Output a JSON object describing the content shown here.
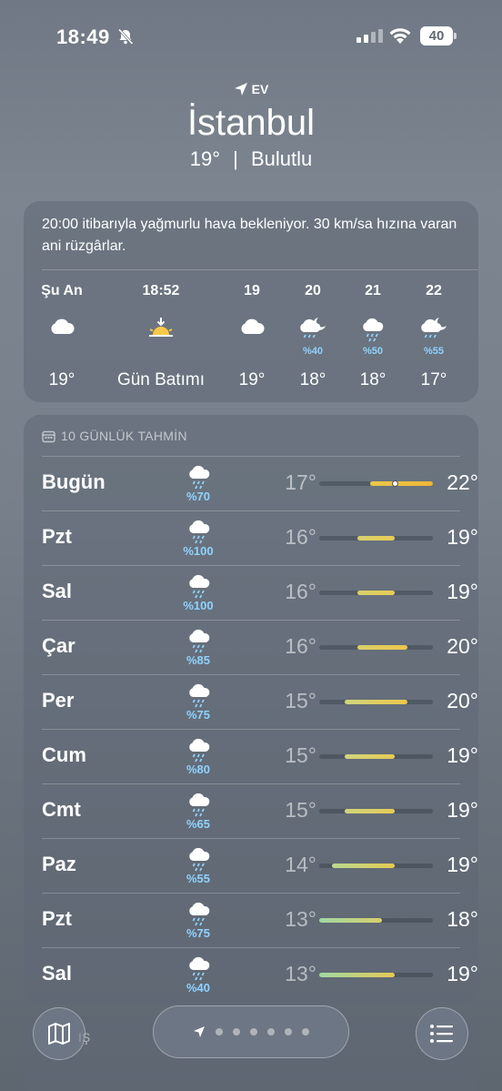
{
  "status_bar": {
    "time": "18:49",
    "battery": "40"
  },
  "location": {
    "tag": "EV",
    "city": "İstanbul",
    "temp": "19°",
    "separator": "|",
    "condition": "Bulutlu"
  },
  "hourly": {
    "summary": "20:00 itibarıyla yağmurlu hava bekleniyor. 30 km/sa hızına varan ani rüzgârlar.",
    "items": [
      {
        "label": "Şu An",
        "icon": "cloud-icon",
        "prob": "",
        "temp": "19°"
      },
      {
        "label": "18:52",
        "icon": "sunset-icon",
        "prob": "",
        "temp": "Gün Batımı"
      },
      {
        "label": "19",
        "icon": "cloud-icon",
        "prob": "",
        "temp": "19°"
      },
      {
        "label": "20",
        "icon": "moon-rain-icon",
        "prob": "%40",
        "temp": "18°"
      },
      {
        "label": "21",
        "icon": "cloud-rain-icon",
        "prob": "%50",
        "temp": "18°"
      },
      {
        "label": "22",
        "icon": "moon-rain-icon",
        "prob": "%55",
        "temp": "17°"
      }
    ]
  },
  "daily": {
    "title": "10 GÜNLÜK TAHMİN",
    "range": {
      "min": 13,
      "max": 22
    },
    "items": [
      {
        "day": "Bugün",
        "prob": "%70",
        "low": "17°",
        "high": "22°",
        "low_val": 17,
        "high_val": 22,
        "current": 19,
        "colors": [
          "#e8c84a",
          "#f2b537"
        ]
      },
      {
        "day": "Pzt",
        "prob": "%100",
        "low": "16°",
        "high": "19°",
        "low_val": 16,
        "high_val": 19,
        "colors": [
          "#d9d06a",
          "#e6cb55"
        ]
      },
      {
        "day": "Sal",
        "prob": "%100",
        "low": "16°",
        "high": "19°",
        "low_val": 16,
        "high_val": 19,
        "colors": [
          "#d9d06a",
          "#e6cb55"
        ]
      },
      {
        "day": "Çar",
        "prob": "%85",
        "low": "16°",
        "high": "20°",
        "low_val": 16,
        "high_val": 20,
        "colors": [
          "#d9d06a",
          "#ecc64a"
        ]
      },
      {
        "day": "Per",
        "prob": "%75",
        "low": "15°",
        "high": "20°",
        "low_val": 15,
        "high_val": 20,
        "colors": [
          "#cfd67c",
          "#ecc64a"
        ]
      },
      {
        "day": "Cum",
        "prob": "%80",
        "low": "15°",
        "high": "19°",
        "low_val": 15,
        "high_val": 19,
        "colors": [
          "#cfd67c",
          "#e6cb55"
        ]
      },
      {
        "day": "Cmt",
        "prob": "%65",
        "low": "15°",
        "high": "19°",
        "low_val": 15,
        "high_val": 19,
        "colors": [
          "#cfd67c",
          "#e6cb55"
        ]
      },
      {
        "day": "Paz",
        "prob": "%55",
        "low": "14°",
        "high": "19°",
        "low_val": 14,
        "high_val": 19,
        "colors": [
          "#b9d98e",
          "#e6cb55"
        ]
      },
      {
        "day": "Pzt",
        "prob": "%75",
        "low": "13°",
        "high": "18°",
        "low_val": 13,
        "high_val": 18,
        "colors": [
          "#9fd8a2",
          "#d9d06a"
        ]
      },
      {
        "day": "Sal",
        "prob": "%40",
        "low": "13°",
        "high": "19°",
        "low_val": 13,
        "high_val": 19,
        "colors": [
          "#9fd8a2",
          "#e6cb55"
        ]
      }
    ]
  },
  "bottom_card": {
    "partial_label": "IŞ"
  },
  "toolbar": {
    "page_count": 6
  }
}
